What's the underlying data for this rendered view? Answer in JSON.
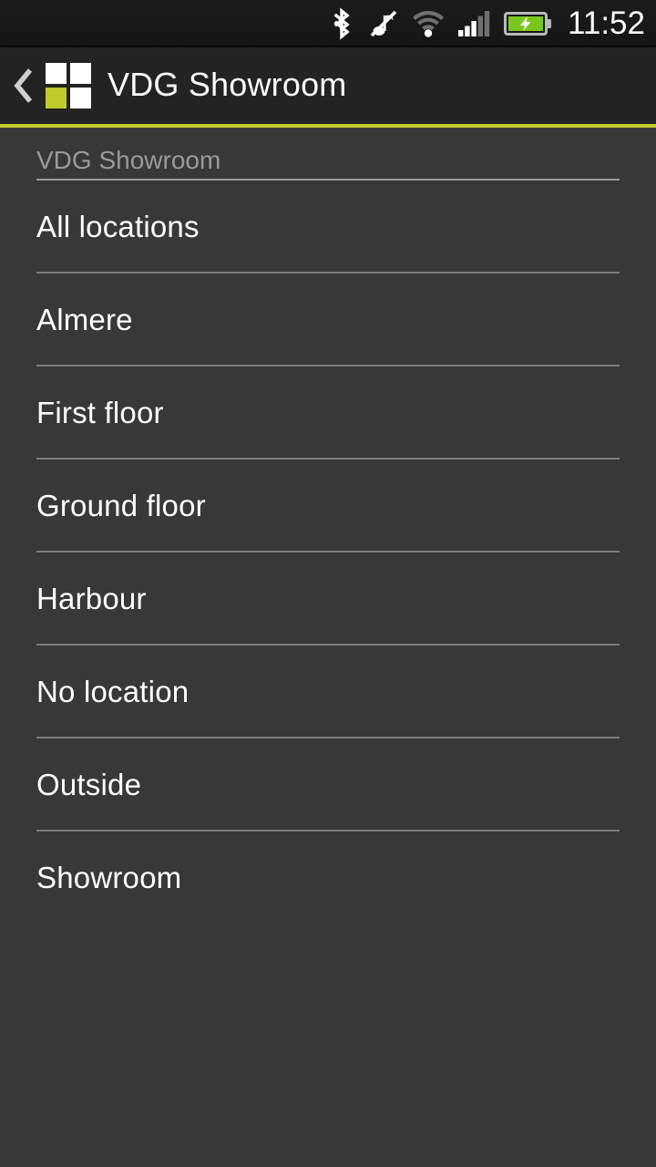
{
  "status_bar": {
    "time": "11:52",
    "icons": [
      {
        "name": "bluetooth-icon",
        "label": "Bluetooth"
      },
      {
        "name": "music-off-icon",
        "label": "Music muted"
      },
      {
        "name": "wifi-icon",
        "label": "Wi-Fi"
      },
      {
        "name": "cellular-signal-icon",
        "label": "Cellular signal"
      },
      {
        "name": "battery-charging-icon",
        "label": "Battery charging"
      }
    ],
    "signal_bars_filled": 3,
    "signal_bars_total": 5,
    "battery_charging": true,
    "colors": {
      "background": "#181818",
      "icon": "#ffffff",
      "icon_dim": "#7a7a7a",
      "battery_green": "#7ac81f"
    }
  },
  "action_bar": {
    "back_label": "Back",
    "title": "VDG Showroom",
    "logo_name": "vdg-logo",
    "logo_tiles": [
      "#ffffff",
      "#ffffff",
      "#c1cc2c",
      "#ffffff"
    ],
    "colors": {
      "background": "#232323",
      "title": "#fbfbfb",
      "accent": "#c1cc2c"
    }
  },
  "list": {
    "header": "VDG Showroom",
    "items": [
      {
        "label": "All locations"
      },
      {
        "label": "Almere"
      },
      {
        "label": "First floor"
      },
      {
        "label": "Ground floor"
      },
      {
        "label": "Harbour"
      },
      {
        "label": "No location"
      },
      {
        "label": "Outside"
      },
      {
        "label": "Showroom"
      }
    ],
    "colors": {
      "background": "#383838",
      "item_text": "#ffffff",
      "header_text": "#9a9a9a",
      "divider": "#9b9b9b"
    }
  }
}
